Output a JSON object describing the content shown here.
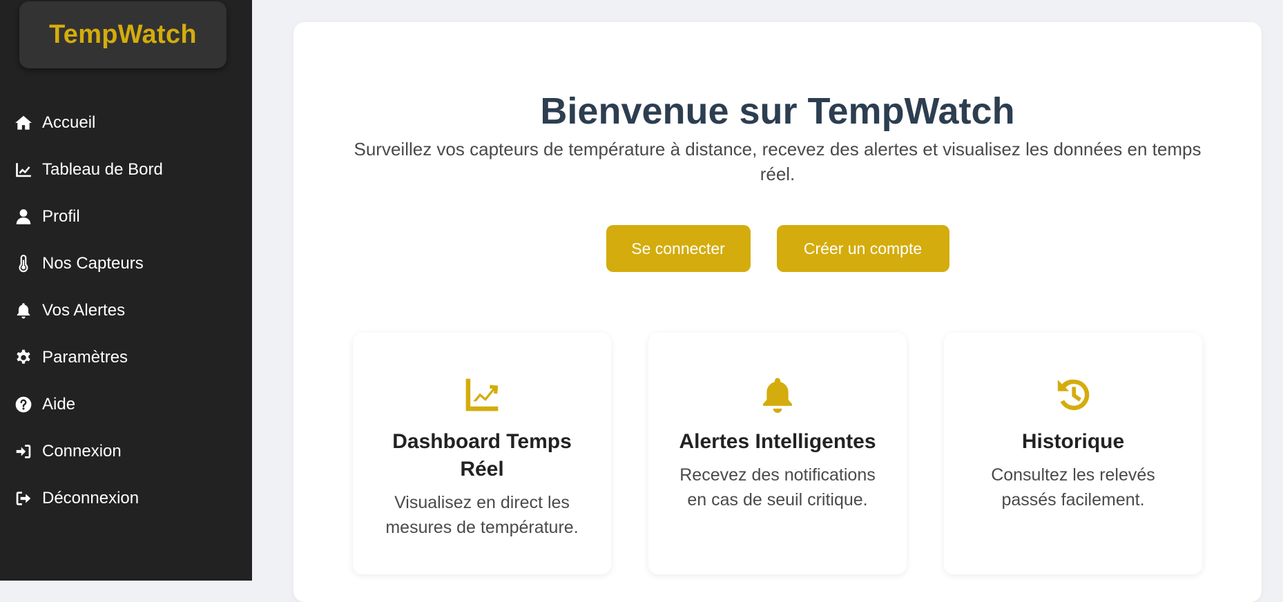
{
  "sidebar": {
    "logo": "TempWatch",
    "items": [
      {
        "label": "Accueil",
        "icon": "home-icon"
      },
      {
        "label": "Tableau de Bord",
        "icon": "chart-line-icon"
      },
      {
        "label": "Profil",
        "icon": "user-icon"
      },
      {
        "label": "Nos Capteurs",
        "icon": "thermometer-icon"
      },
      {
        "label": "Vos Alertes",
        "icon": "bell-icon"
      },
      {
        "label": "Paramètres",
        "icon": "gear-icon"
      },
      {
        "label": "Aide",
        "icon": "question-circle-icon"
      },
      {
        "label": "Connexion",
        "icon": "sign-in-icon"
      },
      {
        "label": "Déconnexion",
        "icon": "sign-out-icon"
      }
    ]
  },
  "hero": {
    "title": "Bienvenue sur TempWatch",
    "subtitle": "Surveillez vos capteurs de température à distance, recevez des alertes et visualisez les données en temps réel.",
    "login_label": "Se connecter",
    "signup_label": "Créer un compte"
  },
  "features": [
    {
      "title": "Dashboard Temps Réel",
      "description": "Visualisez en direct les mesures de température.",
      "icon": "chart-line-icon"
    },
    {
      "title": "Alertes Intelligentes",
      "description": "Recevez des notifications en cas de seuil critique.",
      "icon": "bell-icon"
    },
    {
      "title": "Historique",
      "description": "Consultez les relevés passés facilement.",
      "icon": "history-icon"
    }
  ],
  "colors": {
    "accent": "#d4ac0d",
    "sidebar_bg": "#222222",
    "logo_bg": "#333333",
    "title": "#2c3e50",
    "page_bg": "#eff1f5"
  }
}
